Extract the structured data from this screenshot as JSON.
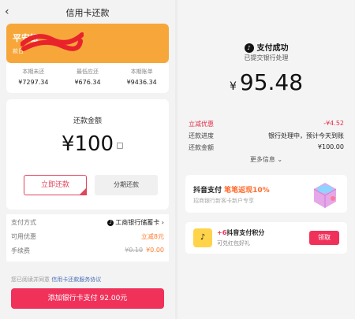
{
  "left": {
    "header": {
      "back_icon": "chevron-left-icon",
      "title": "信用卡还款"
    },
    "card": {
      "name": "平安银",
      "sub": "款日"
    },
    "stats": [
      {
        "label": "本期未还",
        "value": "¥7297.34"
      },
      {
        "label": "最低应还",
        "value": "¥676.34"
      },
      {
        "label": "本期账单",
        "value": "¥9436.34"
      }
    ],
    "amount": {
      "label": "还款金额",
      "value": "¥100"
    },
    "buttons": {
      "pay_now": "立即还款",
      "installment": "分期还款"
    },
    "info": {
      "pay_method_label": "支付方式",
      "pay_method_value": "工商银行储蓄卡",
      "discount_label": "可用优惠",
      "discount_value": "立减8元",
      "fee_label": "手续费",
      "fee_old": "¥0.10",
      "fee_new": "¥0.00"
    },
    "agreement": {
      "prefix": "您已阅读并同意",
      "link": "信用卡还款服务协议"
    },
    "bottom_button": "添加银行卡支付 92.00元"
  },
  "right": {
    "status_title": "支付成功",
    "status_sub": "已提交银行处理",
    "amount_currency": "¥",
    "amount": "95.48",
    "details": [
      {
        "label": "立减优惠",
        "value": "-¥4.52",
        "highlight": true
      },
      {
        "label": "还款进度",
        "value": "银行处理中，预计今天到账",
        "highlight": false
      },
      {
        "label": "还款金额",
        "value": "¥100.00",
        "highlight": false
      }
    ],
    "more": "更多信息",
    "promo": {
      "title_prefix": "抖音支付 ",
      "title_highlight": "笔笔返现10%",
      "subtitle": "招商银行新客卡新户专享"
    },
    "points": {
      "title_highlight": "+6",
      "title_rest": "抖音支付积分",
      "subtitle": "可兑红包好礼",
      "button": "领取"
    }
  },
  "colors": {
    "accent": "#f0325b",
    "card": "#f7a73a",
    "orange": "#ff7a2a"
  }
}
